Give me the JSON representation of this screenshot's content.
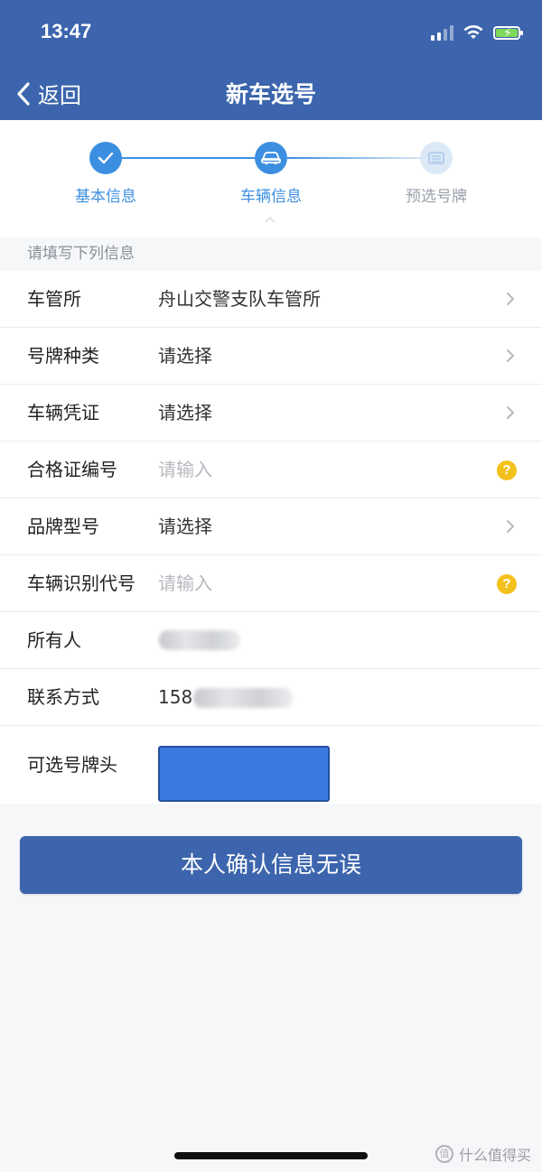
{
  "status_bar": {
    "time": "13:47"
  },
  "nav": {
    "back_label": "返回",
    "title": "新车选号"
  },
  "steps": [
    {
      "label": "基本信息",
      "state": "done"
    },
    {
      "label": "车辆信息",
      "state": "active"
    },
    {
      "label": "预选号牌",
      "state": "pending"
    }
  ],
  "section_hint": "请填写下列信息",
  "form": {
    "office": {
      "label": "车管所",
      "value": "舟山交警支队车管所"
    },
    "plate_type": {
      "label": "号牌种类",
      "value": "请选择"
    },
    "vehicle_cert": {
      "label": "车辆凭证",
      "value": "请选择"
    },
    "cert_number": {
      "label": "合格证编号",
      "placeholder": "请输入"
    },
    "brand_model": {
      "label": "品牌型号",
      "value": "请选择"
    },
    "vin": {
      "label": "车辆识别代号",
      "placeholder": "请输入"
    },
    "owner": {
      "label": "所有人"
    },
    "contact": {
      "label": "联系方式",
      "value": "158"
    },
    "plate_prefix": {
      "label": "可选号牌头"
    }
  },
  "confirm_button": "本人确认信息无误",
  "watermark": "什么值得买",
  "colors": {
    "brand": "#3c65ad",
    "help_icon": "#f3c11b",
    "step_done": "#3c8fe0",
    "plate_fill": "#3a7ae0"
  }
}
